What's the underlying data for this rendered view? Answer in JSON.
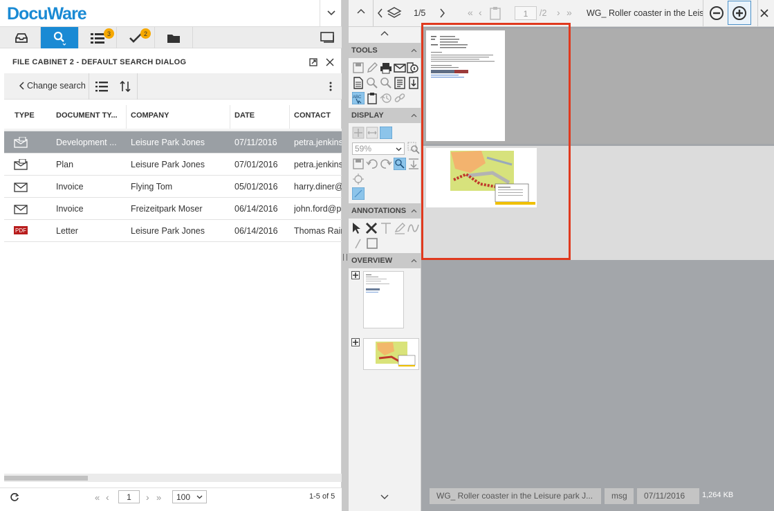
{
  "app": {
    "logo": "DocuWare"
  },
  "nav": {
    "tasks_badge": "3",
    "checks_badge": "2"
  },
  "dialog": {
    "title": "FILE CABINET 2 - DEFAULT SEARCH DIALOG",
    "change_search": "Change search"
  },
  "columns": [
    "TYPE",
    "DOCUMENT TY...",
    "COMPANY",
    "DATE",
    "CONTACT"
  ],
  "rows": [
    {
      "icon": "email-icon",
      "doctype": "Development ...",
      "company": "Leisure Park Jones",
      "date": "07/11/2016",
      "contact": "petra.jenkins@",
      "selected": true
    },
    {
      "icon": "email-icon",
      "doctype": "Plan",
      "company": "Leisure Park Jones",
      "date": "07/01/2016",
      "contact": "petra.jenkins@",
      "selected": false
    },
    {
      "icon": "envelope-icon",
      "doctype": "Invoice",
      "company": "Flying Tom",
      "date": "05/01/2016",
      "contact": "harry.diner@",
      "selected": false
    },
    {
      "icon": "envelope-icon",
      "doctype": "Invoice",
      "company": "Freizeitpark Moser",
      "date": "06/14/2016",
      "contact": "john.ford@p",
      "selected": false
    },
    {
      "icon": "pdf-icon",
      "doctype": "Letter",
      "company": "Leisure Park Jones",
      "date": "06/14/2016",
      "contact": "Thomas Rain",
      "selected": false
    }
  ],
  "pager": {
    "page": "1",
    "page_size": "100",
    "count": "1-5 of 5"
  },
  "viewer": {
    "doc_pos": "1/5",
    "page_input": "1",
    "page_total": "/2",
    "title": "WG_ Roller coaster in the Leis",
    "sections": {
      "tools": "TOOLS",
      "display": "DISPLAY",
      "annotations": "ANNOTATIONS",
      "overview": "OVERVIEW"
    },
    "zoom": "59%",
    "footer": {
      "name": "WG_ Roller coaster in the Leisure park J...",
      "ext": "msg",
      "date": "07/11/2016",
      "size": "1,264 KB"
    }
  },
  "colors": {
    "accent": "#1a8ad4",
    "badge": "#f6a800",
    "highlight": "#e0391e",
    "selected_row": "#9a9fa4"
  }
}
